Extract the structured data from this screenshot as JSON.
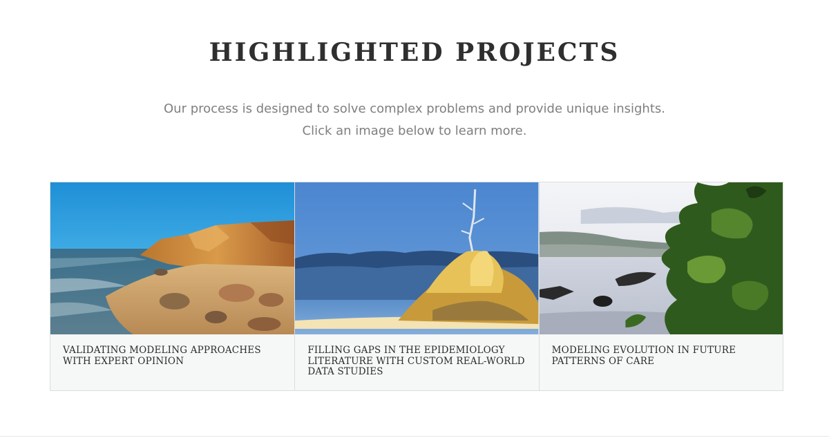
{
  "section": {
    "title": "HIGHLIGHTED PROJECTS",
    "intro_line1": "Our process is designed to solve complex problems and provide unique insights.",
    "intro_line2": "Click an image below to learn more."
  },
  "projects": [
    {
      "title": "VALIDATING MODELING APPROACHES WITH EXPERT OPINION",
      "image": "coastal-cliffs-beach-image"
    },
    {
      "title": "FILLING GAPS IN THE EPIDEMIOLOGY LITERATURE WITH CUSTOM REAL-WORLD DATA STUDIES",
      "image": "autumn-tree-island-image"
    },
    {
      "title": "MODELING EVOLUTION IN FUTURE PATTERNS OF CARE",
      "image": "lake-with-foliage-image"
    }
  ],
  "colors": {
    "title": "#2f2f2f",
    "intro_text": "#7f7f7f",
    "card_background": "#f6f7f7",
    "card_border": "#dcdcdc"
  }
}
